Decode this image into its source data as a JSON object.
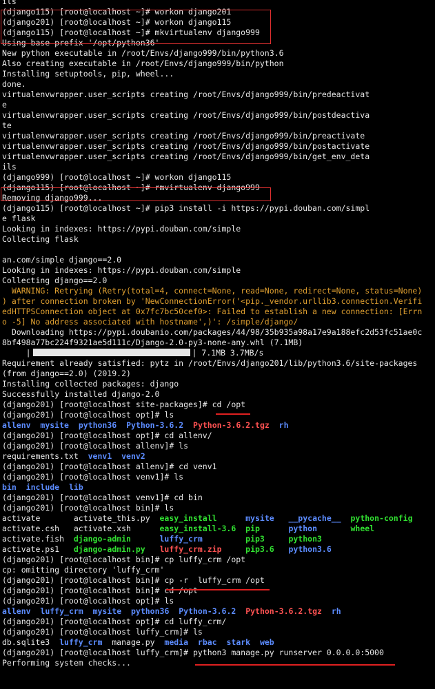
{
  "terminal": {
    "lines": [
      [
        {
          "t": "ils"
        }
      ],
      [
        {
          "t": "(django115) [root@localhost ~]# workon django201"
        }
      ],
      [
        {
          "t": "(django201) [root@localhost ~]# workon django115"
        }
      ],
      [
        {
          "t": "(django115) [root@localhost ~]# mkvirtualenv django999"
        }
      ],
      [
        {
          "t": "Using base prefix '/opt/python36'"
        }
      ],
      [
        {
          "t": "New python executable in /root/Envs/django999/bin/python3.6"
        }
      ],
      [
        {
          "t": "Also creating executable in /root/Envs/django999/bin/python"
        }
      ],
      [
        {
          "t": "Installing setuptools, pip, wheel..."
        }
      ],
      [
        {
          "t": "done."
        }
      ],
      [
        {
          "t": "virtualenvwrapper.user_scripts creating /root/Envs/django999/bin/predeactivat"
        }
      ],
      [
        {
          "t": "e"
        }
      ],
      [
        {
          "t": "virtualenvwrapper.user_scripts creating /root/Envs/django999/bin/postdeactiva"
        }
      ],
      [
        {
          "t": "te"
        }
      ],
      [
        {
          "t": "virtualenvwrapper.user_scripts creating /root/Envs/django999/bin/preactivate"
        }
      ],
      [
        {
          "t": "virtualenvwrapper.user_scripts creating /root/Envs/django999/bin/postactivate"
        }
      ],
      [
        {
          "t": "virtualenvwrapper.user_scripts creating /root/Envs/django999/bin/get_env_deta"
        }
      ],
      [
        {
          "t": "ils"
        }
      ],
      [
        {
          "t": "(django999) [root@localhost ~]# workon django115"
        }
      ],
      [
        {
          "t": "(django115) [root@localhost ~]# rmvirtualenv django999"
        }
      ],
      [
        {
          "t": "Removing django999..."
        }
      ],
      [
        {
          "t": "(django115) [root@localhost ~]# pip3 install -i https://pypi.douban.com/simpl"
        }
      ],
      [
        {
          "t": "e flask"
        }
      ],
      [
        {
          "t": "Looking in indexes: https://pypi.douban.com/simple"
        }
      ],
      [
        {
          "t": "Collecting flask"
        }
      ],
      [
        {
          "t": ""
        }
      ],
      [
        {
          "t": "an.com/simple django==2.0"
        }
      ],
      [
        {
          "t": "Looking in indexes: https://pypi.douban.com/simple"
        }
      ],
      [
        {
          "t": "Collecting django==2.0"
        }
      ],
      [
        {
          "t": "  WARNING: Retrying (Retry(total=4, connect=None, read=None, redirect=None, status=None)",
          "c": "warn"
        }
      ],
      [
        {
          "t": ") after connection broken by 'NewConnectionError('<pip._vendor.urllib3.connection.Verifi",
          "c": "warn"
        }
      ],
      [
        {
          "t": "edHTTPSConnection object at 0x7fc7bc50cef0>: Failed to establish a new connection: [Errn",
          "c": "warn"
        }
      ],
      [
        {
          "t": "o -5] No address associated with hostname',)': /simple/django/",
          "c": "warn"
        }
      ],
      [
        {
          "t": "  Downloading https://pypi.doubanio.com/packages/44/98/35b935a98a17e9a188efc2d53fc51ae0c"
        }
      ],
      [
        {
          "t": "8bf498a77bc224f9321ae5d111c/Django-2.0-py3-none-any.whl (7.1MB)"
        }
      ],
      [
        {
          "t": "     |"
        },
        {
          "t": "",
          "c": "progress"
        },
        {
          "t": "| 7.1MB 3.7MB/s"
        }
      ],
      [
        {
          "t": "Requirement already satisfied: pytz in /root/Envs/django201/lib/python3.6/site-packages"
        }
      ],
      [
        {
          "t": "(from django==2.0) (2019.2)"
        }
      ],
      [
        {
          "t": "Installing collected packages: django"
        }
      ],
      [
        {
          "t": "Successfully installed django-2.0"
        }
      ],
      [
        {
          "t": "(django201) [root@localhost site-packages]# cd /opt"
        }
      ],
      [
        {
          "t": "(django201) [root@localhost opt]# ls"
        }
      ],
      [
        {
          "t": "allenv",
          "c": "blue"
        },
        {
          "t": "  "
        },
        {
          "t": "mysite",
          "c": "blue"
        },
        {
          "t": "  "
        },
        {
          "t": "python36",
          "c": "blue"
        },
        {
          "t": "  "
        },
        {
          "t": "Python-3.6.2",
          "c": "blue"
        },
        {
          "t": "  "
        },
        {
          "t": "Python-3.6.2.tgz",
          "c": "red"
        },
        {
          "t": "  "
        },
        {
          "t": "rh",
          "c": "blue"
        }
      ],
      [
        {
          "t": "(django201) [root@localhost opt]# cd allenv/"
        }
      ],
      [
        {
          "t": "(django201) [root@localhost allenv]# ls"
        }
      ],
      [
        {
          "t": "requirements.txt  "
        },
        {
          "t": "venv1",
          "c": "blue"
        },
        {
          "t": "  "
        },
        {
          "t": "venv2",
          "c": "blue"
        }
      ],
      [
        {
          "t": "(django201) [root@localhost allenv]# cd venv1"
        }
      ],
      [
        {
          "t": "(django201) [root@localhost venv1]# ls"
        }
      ],
      [
        {
          "t": "bin",
          "c": "blue"
        },
        {
          "t": "  "
        },
        {
          "t": "include",
          "c": "blue"
        },
        {
          "t": "  "
        },
        {
          "t": "lib",
          "c": "blue"
        }
      ],
      [
        {
          "t": "(django201) [root@localhost venv1]# cd bin"
        }
      ],
      [
        {
          "t": "(django201) [root@localhost bin]# ls"
        }
      ],
      [
        {
          "t": "activate       activate_this.py  "
        },
        {
          "t": "easy_install",
          "c": "green"
        },
        {
          "t": "      "
        },
        {
          "t": "mysite",
          "c": "blue"
        },
        {
          "t": "   "
        },
        {
          "t": "__pycache__",
          "c": "blue"
        },
        {
          "t": "  "
        },
        {
          "t": "python-config",
          "c": "green"
        }
      ],
      [
        {
          "t": "activate.csh   activate.xsh      "
        },
        {
          "t": "easy_install-3.6",
          "c": "green"
        },
        {
          "t": "  "
        },
        {
          "t": "pip",
          "c": "green"
        },
        {
          "t": "      "
        },
        {
          "t": "python",
          "c": "blue"
        },
        {
          "t": "       "
        },
        {
          "t": "wheel",
          "c": "green"
        }
      ],
      [
        {
          "t": "activate.fish  "
        },
        {
          "t": "django-admin",
          "c": "green"
        },
        {
          "t": "      "
        },
        {
          "t": "luffy_crm",
          "c": "blue"
        },
        {
          "t": "         "
        },
        {
          "t": "pip3",
          "c": "green"
        },
        {
          "t": "     "
        },
        {
          "t": "python3",
          "c": "green"
        }
      ],
      [
        {
          "t": "activate.ps1   "
        },
        {
          "t": "django-admin.py",
          "c": "green"
        },
        {
          "t": "   "
        },
        {
          "t": "luffy_crm.zip",
          "c": "red"
        },
        {
          "t": "     "
        },
        {
          "t": "pip3.6",
          "c": "green"
        },
        {
          "t": "   "
        },
        {
          "t": "python3.6",
          "c": "blue"
        }
      ],
      [
        {
          "t": "(django201) [root@localhost bin]# cp luffy_crm /opt"
        }
      ],
      [
        {
          "t": "cp: omitting directory 'luffy_crm'"
        }
      ],
      [
        {
          "t": "(django201) [root@localhost bin]# cp -r  luffy_crm /opt"
        }
      ],
      [
        {
          "t": "(django201) [root@localhost bin]# cd /opt"
        }
      ],
      [
        {
          "t": "(django201) [root@localhost opt]# ls"
        }
      ],
      [
        {
          "t": "allenv",
          "c": "blue"
        },
        {
          "t": "  "
        },
        {
          "t": "luffy_crm",
          "c": "blue"
        },
        {
          "t": "  "
        },
        {
          "t": "mysite",
          "c": "blue"
        },
        {
          "t": "  "
        },
        {
          "t": "python36",
          "c": "blue"
        },
        {
          "t": "  "
        },
        {
          "t": "Python-3.6.2",
          "c": "blue"
        },
        {
          "t": "  "
        },
        {
          "t": "Python-3.6.2.tgz",
          "c": "red"
        },
        {
          "t": "  "
        },
        {
          "t": "rh",
          "c": "blue"
        }
      ],
      [
        {
          "t": "(django201) [root@localhost opt]# cd luffy_crm/"
        }
      ],
      [
        {
          "t": "(django201) [root@localhost luffy_crm]# ls"
        }
      ],
      [
        {
          "t": "db.sqlite3  "
        },
        {
          "t": "luffy_crm",
          "c": "blue"
        },
        {
          "t": "  manage.py  "
        },
        {
          "t": "media",
          "c": "blue"
        },
        {
          "t": "  "
        },
        {
          "t": "rbac",
          "c": "blue"
        },
        {
          "t": "  "
        },
        {
          "t": "stark",
          "c": "blue"
        },
        {
          "t": "  "
        },
        {
          "t": "web",
          "c": "blue"
        }
      ],
      [
        {
          "t": "(django201) [root@localhost luffy_crm]# python3 manage.py runserver 0.0.0.0:5000"
        }
      ],
      [
        {
          "t": "Performing system checks..."
        }
      ]
    ]
  }
}
